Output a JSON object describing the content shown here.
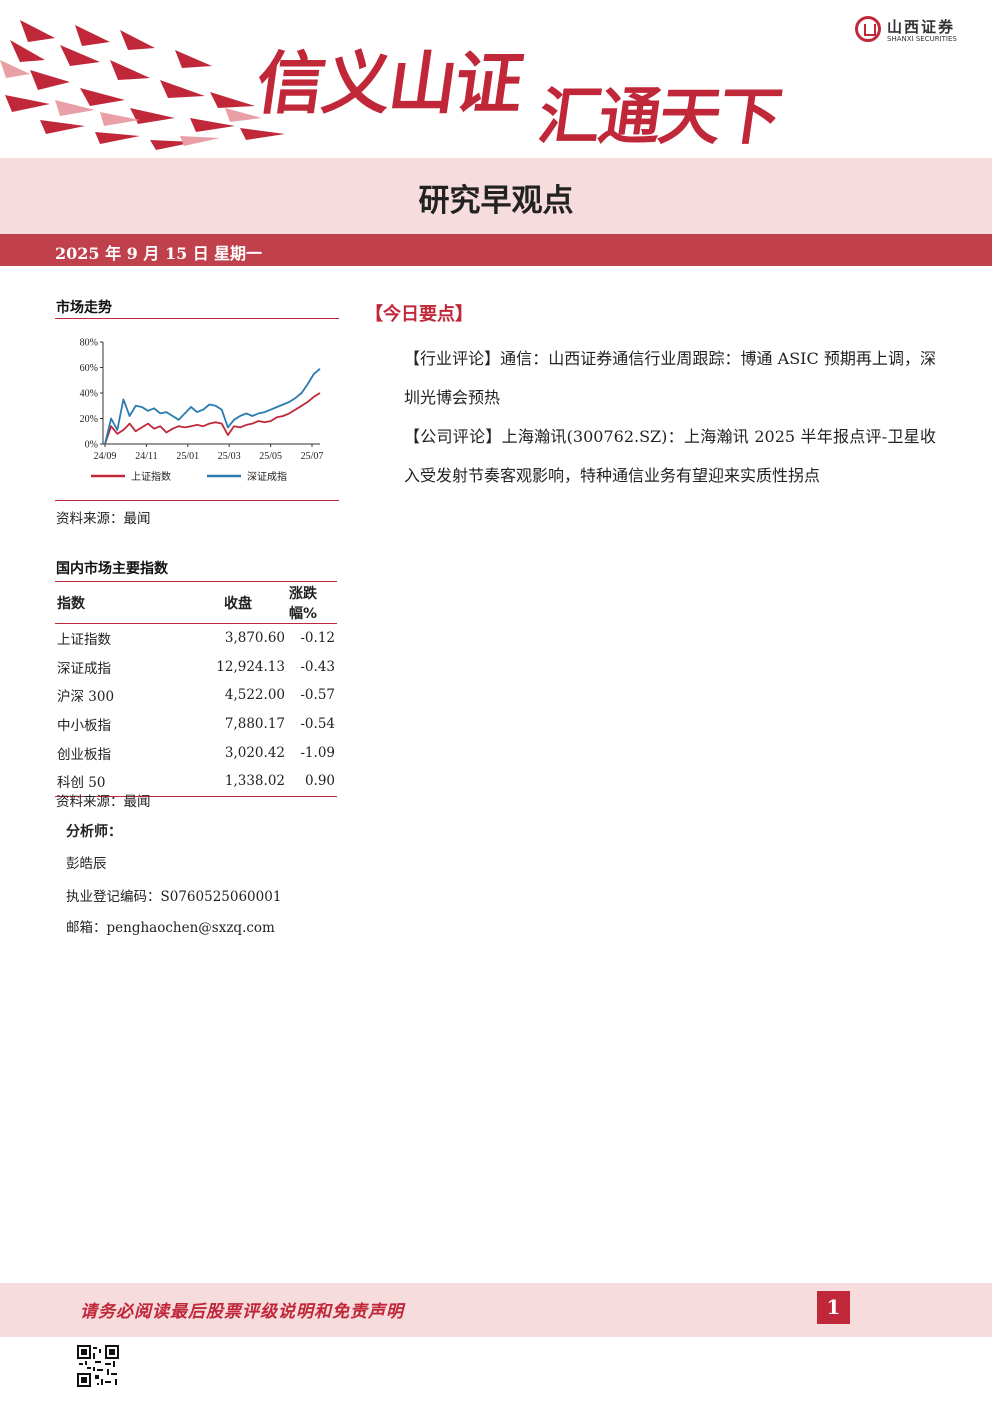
{
  "header": {
    "logo_cn": "山西证券",
    "logo_en": "SHANXI SECURITIES",
    "slogan_1": "信义山证",
    "slogan_2": "汇通天下"
  },
  "title": "研究早观点",
  "date": {
    "date": "2025 年 9 月 15 日",
    "weekday": "星期一"
  },
  "market_trend": {
    "heading": "市场走势",
    "source": "资料来源：最闻",
    "chart_data": {
      "type": "line",
      "x": [
        "24/09",
        "24/11",
        "25/01",
        "25/03",
        "25/05",
        "25/07"
      ],
      "ylim": [
        0,
        80
      ],
      "yticks": [
        "0%",
        "20%",
        "40%",
        "60%",
        "80%"
      ],
      "legend_position": "bottom",
      "series": [
        {
          "name": "上证指数",
          "color": "#c0283a",
          "values": [
            0,
            14,
            8,
            11,
            16,
            10,
            13,
            16,
            12,
            14,
            9,
            12,
            14,
            13,
            14,
            15,
            14,
            16,
            17,
            16,
            7,
            14,
            13,
            15,
            16,
            18,
            17,
            18,
            21,
            22,
            24,
            27,
            30,
            33,
            37,
            40
          ]
        },
        {
          "name": "深证成指",
          "color": "#2a7ab0",
          "values": [
            0,
            20,
            11,
            35,
            22,
            30,
            29,
            26,
            28,
            24,
            25,
            22,
            19,
            24,
            29,
            25,
            27,
            31,
            30,
            27,
            13,
            19,
            22,
            24,
            22,
            24,
            25,
            27,
            29,
            31,
            33,
            36,
            40,
            47,
            55,
            59
          ]
        }
      ]
    }
  },
  "indices": {
    "heading": "国内市场主要指数",
    "columns": [
      "指数",
      "收盘",
      "涨跌幅%"
    ],
    "rows": [
      [
        "上证指数",
        "3,870.60",
        "-0.12"
      ],
      [
        "深证成指",
        "12,924.13",
        "-0.43"
      ],
      [
        "沪深 300",
        "4,522.00",
        "-0.57"
      ],
      [
        "中小板指",
        "7,880.17",
        "-0.54"
      ],
      [
        "创业板指",
        "3,020.42",
        "-1.09"
      ],
      [
        "科创 50",
        "1,338.02",
        "0.90"
      ]
    ],
    "source": "资料来源：最闻"
  },
  "analyst": {
    "label": "分析师：",
    "name": "彭皓辰",
    "reg": "执业登记编码：S0760525060001",
    "email": "邮箱：penghaochen@sxzq.com"
  },
  "today": {
    "heading": "【今日要点】",
    "items": [
      "【行业评论】通信：山西证券通信行业周跟踪：博通 ASIC 预期再上调，深圳光博会预热",
      "【公司评论】上海瀚讯(300762.SZ)：上海瀚讯 2025 半年报点评-卫星收入受发射节奏客观影响，特种通信业务有望迎来实质性拐点"
    ]
  },
  "footer": {
    "disclaimer": "请务必阅读最后股票评级说明和免责声明",
    "page": "1"
  }
}
